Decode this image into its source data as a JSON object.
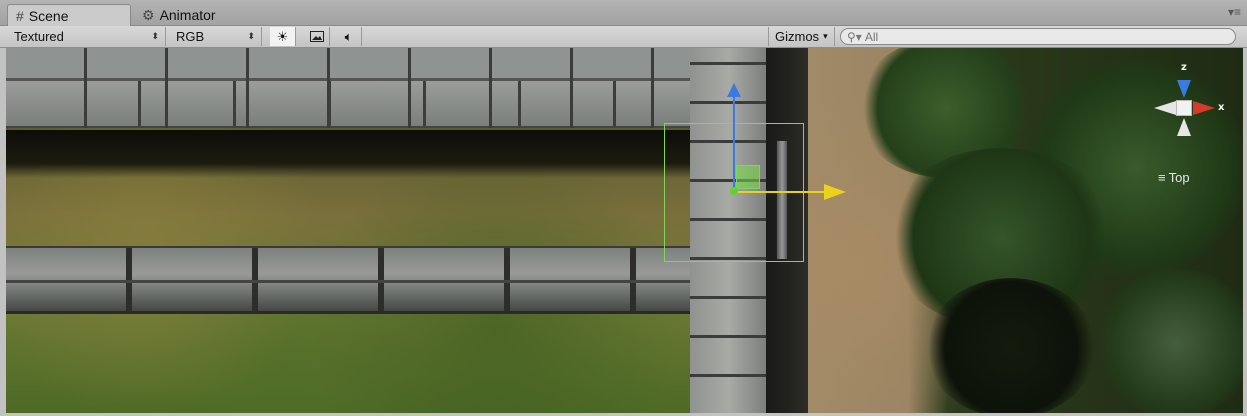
{
  "tabs": [
    {
      "icon": "#",
      "label": "Scene",
      "active": true
    },
    {
      "icon": "⚙",
      "label": "Animator",
      "active": false
    }
  ],
  "toolbar": {
    "render_mode": "Textured",
    "color_mode": "RGB",
    "gizmos_label": "Gizmos",
    "search_placeholder": "All"
  },
  "orientation": {
    "z_label": "z",
    "x_label": "x",
    "view_label": "Top"
  },
  "colors": {
    "axis_x": "#d63a2a",
    "axis_y": "#3b7ae0",
    "axis_z_move": "#e8d21b",
    "selection": "#7ed65a"
  }
}
